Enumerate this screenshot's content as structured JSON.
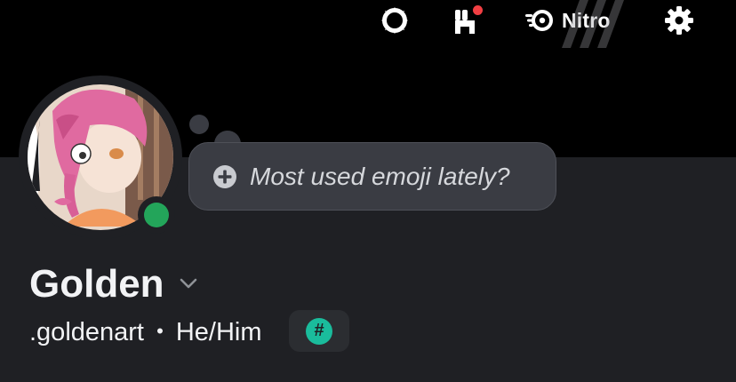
{
  "topbar": {
    "nitro_label": "Nitro",
    "icons": [
      "quests-icon",
      "shop-icon",
      "nitro-icon",
      "settings-icon"
    ],
    "notification_dot_color": "#f23f43"
  },
  "avatar": {
    "status": "online",
    "status_color": "#23a55a"
  },
  "status_bubble": {
    "placeholder": "Most used emoji lately?",
    "icon": "plus-circle-icon"
  },
  "profile": {
    "display_name": "Golden",
    "username": ".goldenart",
    "separator": "•",
    "pronouns": "He/Him",
    "badge_symbol": "#",
    "badge_color": "#1abc9c"
  },
  "colors": {
    "banner": "#000000",
    "panel": "#1f2024",
    "bubble": "#3a3c43"
  }
}
